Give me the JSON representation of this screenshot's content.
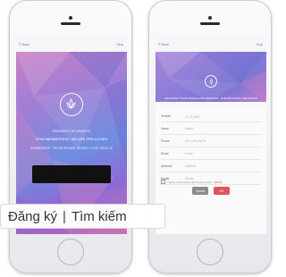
{
  "caption": {
    "signup": "Đăng ký",
    "separator": "|",
    "search": "Tìm kiếm"
  },
  "left_screen": {
    "nav_back": "Back",
    "nav_right": "Skip",
    "text_a": "REMEMBER THE MOMENTS",
    "text_b": "STAR MEMBERSHIP, WE ARE PRIVILEGED",
    "text_c": "MEMBERSHIP · REGISTER AND SEARCH YOUR VEHICLE"
  },
  "right_screen": {
    "nav_back": "Back",
    "nav_right": "Skip",
    "hero_text_1": "REGISTER YOUR VEHICLE INFORMATION · PLEASE ENTER THE FIELDS",
    "hero_text_2": "MEMBERSHIP REGISTRATION · PLEASE ENTER",
    "fields": [
      {
        "label": "Vehicle",
        "value": "12 가 3456"
      },
      {
        "label": "Name",
        "value": "Name"
      },
      {
        "label": "Phone",
        "value": "010-1234-5678"
      },
      {
        "label": "Email",
        "value": "Email"
      },
      {
        "label": "Address",
        "value": "Address"
      },
      {
        "label": "Model",
        "value": "Model"
      }
    ],
    "agree_text": "I agree to the terms and privacy policy",
    "agree_link": "[View]",
    "cancel_label": "Cancel",
    "confirm_label": "OK"
  },
  "colors": {
    "accent_red": "#e0525d",
    "gray_button": "#8b8b92",
    "gradient_purple": "#9b7fd6"
  }
}
